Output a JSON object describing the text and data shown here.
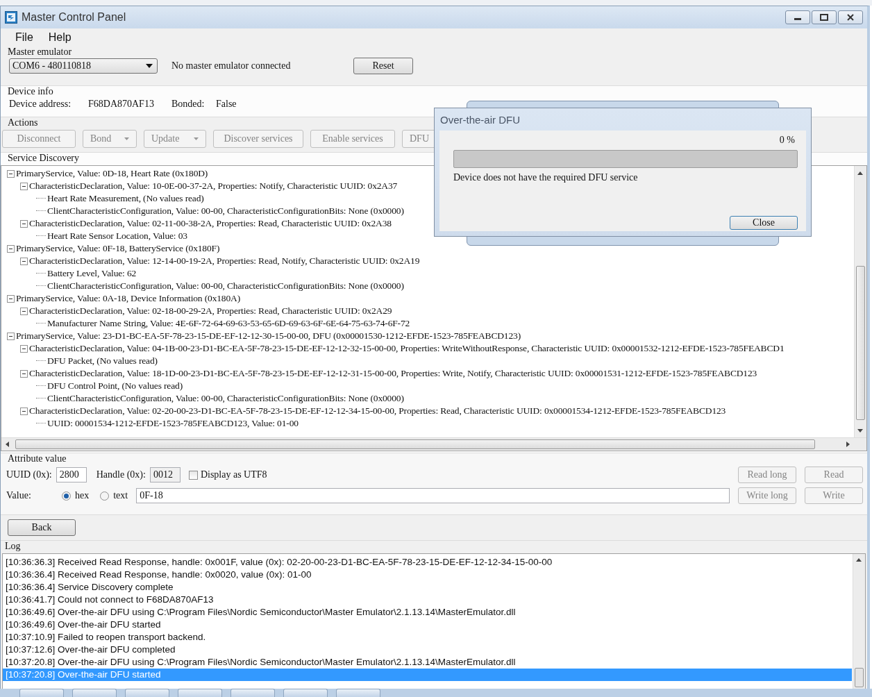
{
  "window": {
    "title": "Master Control Panel"
  },
  "menu": [
    "File",
    "Help"
  ],
  "master_emulator": {
    "label": "Master emulator",
    "port": "COM6 - 480110818",
    "status": "No master emulator connected",
    "reset_button": {
      "label": "Reset",
      "disabled": false
    }
  },
  "device_info": {
    "label": "Device info",
    "address_label": "Device address:",
    "address": "F68DA870AF13",
    "bonded_label": "Bonded:",
    "bonded": "False"
  },
  "actions": {
    "label": "Actions",
    "buttons": [
      {
        "label": "Disconnect",
        "kind": "plain",
        "disabled": true
      },
      {
        "label": "Bond",
        "kind": "split",
        "disabled": true
      },
      {
        "label": "Update",
        "kind": "split",
        "disabled": true
      },
      {
        "label": "Discover services",
        "kind": "plain",
        "disabled": true
      },
      {
        "label": "Enable services",
        "kind": "plain",
        "disabled": true
      },
      {
        "label": "DFU",
        "kind": "plain",
        "disabled": true
      }
    ]
  },
  "service_discovery": {
    "label": "Service Discovery",
    "tree": [
      {
        "text": "PrimaryService, Value: 0D-18, Heart Rate (0x180D)",
        "expanded": true,
        "children": [
          {
            "text": "CharacteristicDeclaration, Value: 10-0E-00-37-2A, Properties: Notify, Characteristic UUID: 0x2A37",
            "expanded": true,
            "children": [
              {
                "text": "Heart Rate Measurement, (No values read)"
              },
              {
                "text": "ClientCharacteristicConfiguration, Value: 00-00, CharacteristicConfigurationBits: None (0x0000)"
              }
            ]
          },
          {
            "text": "CharacteristicDeclaration, Value: 02-11-00-38-2A, Properties: Read, Characteristic UUID: 0x2A38",
            "expanded": true,
            "children": [
              {
                "text": "Heart Rate Sensor Location, Value: 03"
              }
            ]
          }
        ]
      },
      {
        "text": "PrimaryService, Value: 0F-18, BatteryService (0x180F)",
        "expanded": true,
        "children": [
          {
            "text": "CharacteristicDeclaration, Value: 12-14-00-19-2A, Properties: Read, Notify, Characteristic UUID: 0x2A19",
            "expanded": true,
            "children": [
              {
                "text": "Battery Level, Value: 62"
              },
              {
                "text": "ClientCharacteristicConfiguration, Value: 00-00, CharacteristicConfigurationBits: None (0x0000)"
              }
            ]
          }
        ]
      },
      {
        "text": "PrimaryService, Value: 0A-18, Device Information (0x180A)",
        "expanded": true,
        "children": [
          {
            "text": "CharacteristicDeclaration, Value: 02-18-00-29-2A, Properties: Read, Characteristic UUID: 0x2A29",
            "expanded": true,
            "children": [
              {
                "text": "Manufacturer Name String, Value: 4E-6F-72-64-69-63-53-65-6D-69-63-6F-6E-64-75-63-74-6F-72"
              }
            ]
          }
        ]
      },
      {
        "text": "PrimaryService, Value: 23-D1-BC-EA-5F-78-23-15-DE-EF-12-12-30-15-00-00, DFU (0x00001530-1212-EFDE-1523-785FEABCD123)",
        "expanded": true,
        "children": [
          {
            "text": "CharacteristicDeclaration, Value: 04-1B-00-23-D1-BC-EA-5F-78-23-15-DE-EF-12-12-32-15-00-00, Properties: WriteWithoutResponse, Characteristic UUID: 0x00001532-1212-EFDE-1523-785FEABCD1",
            "expanded": true,
            "children": [
              {
                "text": "DFU Packet, (No values read)"
              }
            ]
          },
          {
            "text": "CharacteristicDeclaration, Value: 18-1D-00-23-D1-BC-EA-5F-78-23-15-DE-EF-12-12-31-15-00-00, Properties: Write, Notify, Characteristic UUID: 0x00001531-1212-EFDE-1523-785FEABCD123",
            "expanded": true,
            "children": [
              {
                "text": "DFU Control Point, (No values read)"
              },
              {
                "text": "ClientCharacteristicConfiguration, Value: 00-00, CharacteristicConfigurationBits: None (0x0000)"
              }
            ]
          },
          {
            "text": "CharacteristicDeclaration, Value: 02-20-00-23-D1-BC-EA-5F-78-23-15-DE-EF-12-12-34-15-00-00, Properties: Read, Characteristic UUID: 0x00001534-1212-EFDE-1523-785FEABCD123",
            "expanded": true,
            "children": [
              {
                "text": "UUID: 00001534-1212-EFDE-1523-785FEABCD123, Value: 01-00"
              }
            ]
          }
        ]
      }
    ]
  },
  "attribute_value": {
    "label": "Attribute value",
    "uuid_label": "UUID (0x):",
    "uuid": "2800",
    "handle_label": "Handle (0x):",
    "handle": "0012",
    "utf8": {
      "label": "Display as UTF8",
      "checked": false
    },
    "value_label": "Value:",
    "formats": [
      {
        "label": "hex",
        "selected": true
      },
      {
        "label": "text",
        "selected": false
      }
    ],
    "value": "0F-18",
    "buttons": [
      {
        "label": "Read long",
        "disabled": true
      },
      {
        "label": "Read",
        "disabled": true
      },
      {
        "label": "Write long",
        "disabled": true
      },
      {
        "label": "Write",
        "disabled": true
      }
    ]
  },
  "back_button": {
    "label": "Back",
    "disabled": false
  },
  "log": {
    "label": "Log",
    "entries": [
      {
        "text": "[10:36:36.3] Received Read Response, handle: 0x001F, value (0x): 02-20-00-23-D1-BC-EA-5F-78-23-15-DE-EF-12-12-34-15-00-00",
        "selected": false
      },
      {
        "text": "[10:36:36.4] Received Read Response, handle: 0x0020, value (0x): 01-00",
        "selected": false
      },
      {
        "text": "[10:36:36.4] Service Discovery complete",
        "selected": false
      },
      {
        "text": "[10:36:41.7] Could not connect to F68DA870AF13",
        "selected": false
      },
      {
        "text": "[10:36:49.6] Over-the-air DFU using C:\\Program Files\\Nordic Semiconductor\\Master Emulator\\2.1.13.14\\MasterEmulator.dll",
        "selected": false
      },
      {
        "text": "[10:36:49.6] Over-the-air DFU started",
        "selected": false
      },
      {
        "text": "[10:37:10.9] Failed to reopen transport backend.",
        "selected": false
      },
      {
        "text": "[10:37:12.6] Over-the-air DFU completed",
        "selected": false
      },
      {
        "text": "[10:37:20.8] Over-the-air DFU using C:\\Program Files\\Nordic Semiconductor\\Master Emulator\\2.1.13.14\\MasterEmulator.dll",
        "selected": false
      },
      {
        "text": "[10:37:20.8] Over-the-air DFU started",
        "selected": true
      }
    ]
  },
  "dialog": {
    "title": "Over-the-air DFU",
    "percent": "0 %",
    "level": 0,
    "message": "Device does not have the required DFU service",
    "button": "Close"
  }
}
